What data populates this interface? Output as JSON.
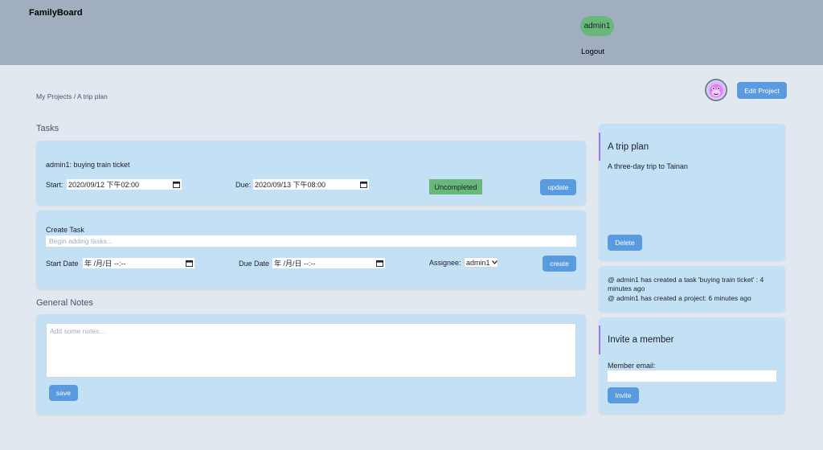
{
  "app": {
    "brand": "FamilyBoard"
  },
  "header": {
    "username": "admin1",
    "logout_label": "Logout"
  },
  "breadcrumb": "My Projects / A trip plan",
  "toolbar": {
    "edit_project_label": "Edit Project"
  },
  "tasks_heading": "Tasks",
  "task": {
    "title": "admin1: buying train ticket",
    "start_label": "Start:",
    "start_value": "2020/09/12 下午02:00",
    "due_label": "Due:",
    "due_value": "2020/09/13 下午08:00",
    "status": "Uncompleted",
    "update_label": "update"
  },
  "create_task": {
    "title": "Create Task",
    "placeholder": "Begin adding tasks...",
    "start_label": "Start Date",
    "start_value": "年 /月/日 --:--",
    "due_label": "Due Date",
    "due_value": "年 /月/日 --:--",
    "assignee_label": "Assignee:",
    "assignee_value": "admin1",
    "create_label": "create"
  },
  "notes": {
    "heading": "General Notes",
    "placeholder": "Add some notes...",
    "save_label": "save"
  },
  "project": {
    "title": "A trip plan",
    "description": "A three-day trip to Tainan",
    "delete_label": "Delete"
  },
  "activity": [
    "@ admin1 has created a task 'buying train ticket' : 4 minutes ago",
    "@ admin1 has created a project: 6 minutes ago"
  ],
  "invite": {
    "title": "Invite a member",
    "email_label": "Member email:",
    "invite_label": "Invite"
  },
  "colors": {
    "topbar": "#a0aec0",
    "background": "#e2e8f0",
    "card": "#c4e0f4",
    "button": "#5a9be0",
    "status_green": "#68b979",
    "accent_purple": "#9f7aea"
  },
  "icons": {
    "calendar": "calendar-icon",
    "avatar": "monkey-avatar-icon",
    "dropdown": "chevron-down-icon"
  }
}
